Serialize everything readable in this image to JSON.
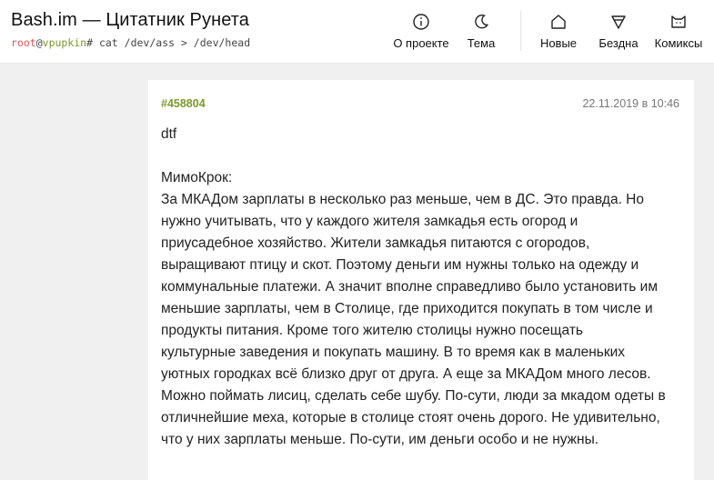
{
  "header": {
    "site_title": "Bash.im — Цитатник Рунета",
    "prompt": {
      "user": "root",
      "at": "@",
      "host": "vpupkin",
      "command": "# cat /dev/ass > /dev/head"
    },
    "nav": [
      {
        "label": "О проекте",
        "icon": "info-icon"
      },
      {
        "label": "Тема",
        "icon": "moon-icon"
      },
      {
        "label": "Новые",
        "icon": "home-icon"
      },
      {
        "label": "Бездна",
        "icon": "abyss-icon"
      },
      {
        "label": "Комиксы",
        "icon": "comics-icon"
      }
    ]
  },
  "quote": {
    "id": "#458804",
    "date": "22.11.2019 в 10:46",
    "lines": [
      "dtf",
      "",
      "МимоКрок:",
      "За МКАДом зарплаты в несколько раз меньше, чем в ДС. Это правда. Но",
      "нужно учитывать, что у каждого жителя замкадья есть огород и",
      "приусадебное хозяйство. Жители замкадья питаются с огородов,",
      "выращивают птицу и скот. Поэтому деньги им нужны только на одежду и",
      "коммунальные платежи. А значит вполне справедливо было установить им",
      "меньшие зарплаты, чем в Столице, где приходится покупать в том числе и",
      "продукты питания. Кроме того жителю столицы нужно посещать",
      "культурные заведения и покупать машину. В то время как в маленьких",
      "уютных городках всё близко друг от друга. А еще за МКАДом много лесов.",
      "Можно поймать лисиц, сделать себе шубу. По-сути, люди за мкадом одеты в",
      "отличнейшие меха, которые в столице стоят очень дорого. Не удивительно,",
      "что у них зарплаты меньше. По-сути, им деньги особо и не нужны."
    ]
  }
}
